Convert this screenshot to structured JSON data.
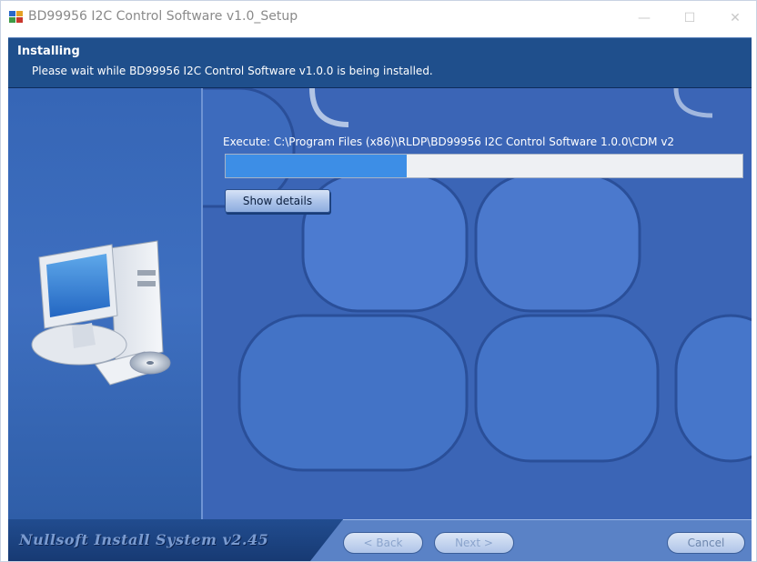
{
  "window": {
    "title": "BD99956 I2C Control Software v1.0_Setup",
    "controls": {
      "minimize": "—",
      "maximize": "☐",
      "close": "✕"
    }
  },
  "header": {
    "title": "Installing",
    "subtitle": "Please wait while BD99956 I2C Control Software v1.0.0 is being installed."
  },
  "main": {
    "execute_text": "Execute: C:\\Program Files (x86)\\RLDP\\BD99956 I2C Control Software 1.0.0\\CDM v2",
    "progress_percent": 35,
    "show_details_label": "Show details"
  },
  "footer": {
    "brand": "Nullsoft Install System v2.45",
    "back_label": "< Back",
    "next_label": "Next >",
    "cancel_label": "Cancel"
  },
  "colors": {
    "header_bg": "#1f4f8c",
    "body_bg": "#3a66b8",
    "progress_fill": "#3d8ee6",
    "footer_bg": "#173a73"
  },
  "icons": {
    "app": "installer-icon",
    "illustration": "computer-cd-icon"
  }
}
